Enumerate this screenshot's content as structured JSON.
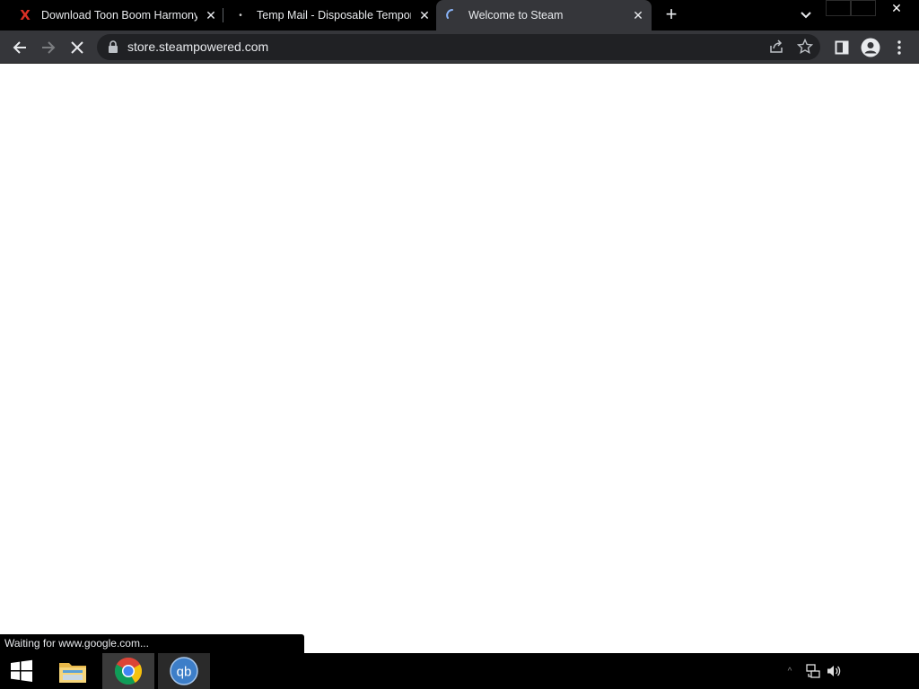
{
  "tabs": [
    {
      "title": "Download Toon Boom Harmony",
      "favicon": "x-icon",
      "close": "✕"
    },
    {
      "title": "Temp Mail - Disposable Tempora",
      "favicon": "tempmail-icon",
      "close": "✕"
    },
    {
      "title": "Welcome to Steam",
      "favicon": "loading-spinner-icon",
      "close": "✕",
      "active": true
    }
  ],
  "tab_strip": {
    "new_tab": "+",
    "tab_search_icon": "chevron-down-icon"
  },
  "window": {
    "close": "✕"
  },
  "toolbar": {
    "url": "store.steampowered.com",
    "back_icon": "arrow-left-icon",
    "forward_icon": "arrow-right-icon",
    "stop_icon": "close-icon",
    "stop_glyph": "✕"
  },
  "status": {
    "text": "Waiting for www.google.com..."
  },
  "taskbar": {
    "items": [
      "windows-start-icon",
      "file-explorer-icon",
      "chrome-icon",
      "qbittorrent-icon"
    ],
    "qb_label": "qb",
    "tray_chevron": "^"
  },
  "colors": {
    "tab_strip": "#000000",
    "toolbar": "#35363a",
    "omnibox": "#202124",
    "text": "#e8eaed",
    "page": "#ffffff"
  }
}
